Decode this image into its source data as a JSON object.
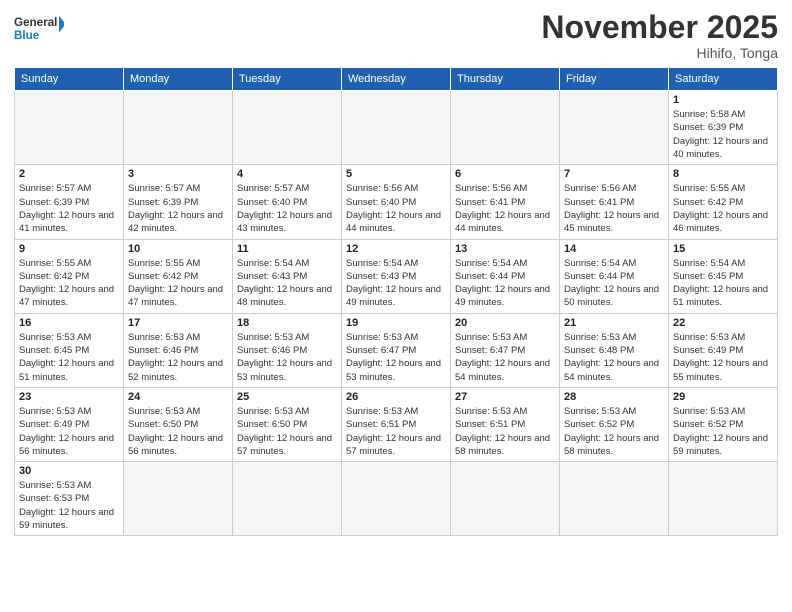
{
  "header": {
    "logo_general": "General",
    "logo_blue": "Blue",
    "month_title": "November 2025",
    "location": "Hihifo, Tonga"
  },
  "weekdays": [
    "Sunday",
    "Monday",
    "Tuesday",
    "Wednesday",
    "Thursday",
    "Friday",
    "Saturday"
  ],
  "weeks": [
    [
      {
        "day": "",
        "info": ""
      },
      {
        "day": "",
        "info": ""
      },
      {
        "day": "",
        "info": ""
      },
      {
        "day": "",
        "info": ""
      },
      {
        "day": "",
        "info": ""
      },
      {
        "day": "",
        "info": ""
      },
      {
        "day": "1",
        "info": "Sunrise: 5:58 AM\nSunset: 6:39 PM\nDaylight: 12 hours and 40 minutes."
      }
    ],
    [
      {
        "day": "2",
        "info": "Sunrise: 5:57 AM\nSunset: 6:39 PM\nDaylight: 12 hours and 41 minutes."
      },
      {
        "day": "3",
        "info": "Sunrise: 5:57 AM\nSunset: 6:39 PM\nDaylight: 12 hours and 42 minutes."
      },
      {
        "day": "4",
        "info": "Sunrise: 5:57 AM\nSunset: 6:40 PM\nDaylight: 12 hours and 43 minutes."
      },
      {
        "day": "5",
        "info": "Sunrise: 5:56 AM\nSunset: 6:40 PM\nDaylight: 12 hours and 44 minutes."
      },
      {
        "day": "6",
        "info": "Sunrise: 5:56 AM\nSunset: 6:41 PM\nDaylight: 12 hours and 44 minutes."
      },
      {
        "day": "7",
        "info": "Sunrise: 5:56 AM\nSunset: 6:41 PM\nDaylight: 12 hours and 45 minutes."
      },
      {
        "day": "8",
        "info": "Sunrise: 5:55 AM\nSunset: 6:42 PM\nDaylight: 12 hours and 46 minutes."
      }
    ],
    [
      {
        "day": "9",
        "info": "Sunrise: 5:55 AM\nSunset: 6:42 PM\nDaylight: 12 hours and 47 minutes."
      },
      {
        "day": "10",
        "info": "Sunrise: 5:55 AM\nSunset: 6:42 PM\nDaylight: 12 hours and 47 minutes."
      },
      {
        "day": "11",
        "info": "Sunrise: 5:54 AM\nSunset: 6:43 PM\nDaylight: 12 hours and 48 minutes."
      },
      {
        "day": "12",
        "info": "Sunrise: 5:54 AM\nSunset: 6:43 PM\nDaylight: 12 hours and 49 minutes."
      },
      {
        "day": "13",
        "info": "Sunrise: 5:54 AM\nSunset: 6:44 PM\nDaylight: 12 hours and 49 minutes."
      },
      {
        "day": "14",
        "info": "Sunrise: 5:54 AM\nSunset: 6:44 PM\nDaylight: 12 hours and 50 minutes."
      },
      {
        "day": "15",
        "info": "Sunrise: 5:54 AM\nSunset: 6:45 PM\nDaylight: 12 hours and 51 minutes."
      }
    ],
    [
      {
        "day": "16",
        "info": "Sunrise: 5:53 AM\nSunset: 6:45 PM\nDaylight: 12 hours and 51 minutes."
      },
      {
        "day": "17",
        "info": "Sunrise: 5:53 AM\nSunset: 6:46 PM\nDaylight: 12 hours and 52 minutes."
      },
      {
        "day": "18",
        "info": "Sunrise: 5:53 AM\nSunset: 6:46 PM\nDaylight: 12 hours and 53 minutes."
      },
      {
        "day": "19",
        "info": "Sunrise: 5:53 AM\nSunset: 6:47 PM\nDaylight: 12 hours and 53 minutes."
      },
      {
        "day": "20",
        "info": "Sunrise: 5:53 AM\nSunset: 6:47 PM\nDaylight: 12 hours and 54 minutes."
      },
      {
        "day": "21",
        "info": "Sunrise: 5:53 AM\nSunset: 6:48 PM\nDaylight: 12 hours and 54 minutes."
      },
      {
        "day": "22",
        "info": "Sunrise: 5:53 AM\nSunset: 6:49 PM\nDaylight: 12 hours and 55 minutes."
      }
    ],
    [
      {
        "day": "23",
        "info": "Sunrise: 5:53 AM\nSunset: 6:49 PM\nDaylight: 12 hours and 56 minutes."
      },
      {
        "day": "24",
        "info": "Sunrise: 5:53 AM\nSunset: 6:50 PM\nDaylight: 12 hours and 56 minutes."
      },
      {
        "day": "25",
        "info": "Sunrise: 5:53 AM\nSunset: 6:50 PM\nDaylight: 12 hours and 57 minutes."
      },
      {
        "day": "26",
        "info": "Sunrise: 5:53 AM\nSunset: 6:51 PM\nDaylight: 12 hours and 57 minutes."
      },
      {
        "day": "27",
        "info": "Sunrise: 5:53 AM\nSunset: 6:51 PM\nDaylight: 12 hours and 58 minutes."
      },
      {
        "day": "28",
        "info": "Sunrise: 5:53 AM\nSunset: 6:52 PM\nDaylight: 12 hours and 58 minutes."
      },
      {
        "day": "29",
        "info": "Sunrise: 5:53 AM\nSunset: 6:52 PM\nDaylight: 12 hours and 59 minutes."
      }
    ],
    [
      {
        "day": "30",
        "info": "Sunrise: 5:53 AM\nSunset: 6:53 PM\nDaylight: 12 hours and 59 minutes."
      },
      {
        "day": "",
        "info": ""
      },
      {
        "day": "",
        "info": ""
      },
      {
        "day": "",
        "info": ""
      },
      {
        "day": "",
        "info": ""
      },
      {
        "day": "",
        "info": ""
      },
      {
        "day": "",
        "info": ""
      }
    ]
  ]
}
